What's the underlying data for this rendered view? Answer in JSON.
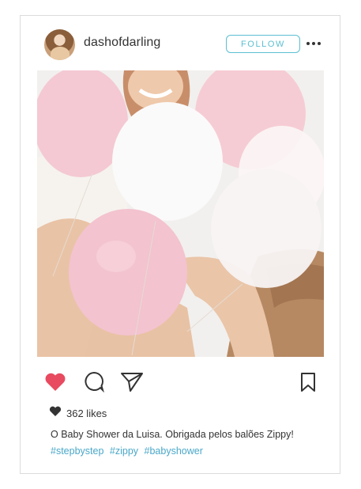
{
  "post": {
    "username": "dashofdarling",
    "follow_label": "FOLLOW",
    "likes": "362 likes",
    "caption": "O Baby Shower da Luisa. Obrigada pelos balões Zippy!",
    "hashtags": [
      "#stepbystep",
      "#zippy",
      "#babyshower"
    ]
  },
  "icons": {
    "like": "heart-icon",
    "comment": "comment-bubble-icon",
    "share": "send-icon",
    "save": "bookmark-icon",
    "more": "more-dots-icon",
    "likes": "small-heart-icon"
  },
  "colors": {
    "accent": "#5bbfd1",
    "like_red": "#e84a5f",
    "hashtag": "#4aa8c9",
    "text": "#333333"
  }
}
